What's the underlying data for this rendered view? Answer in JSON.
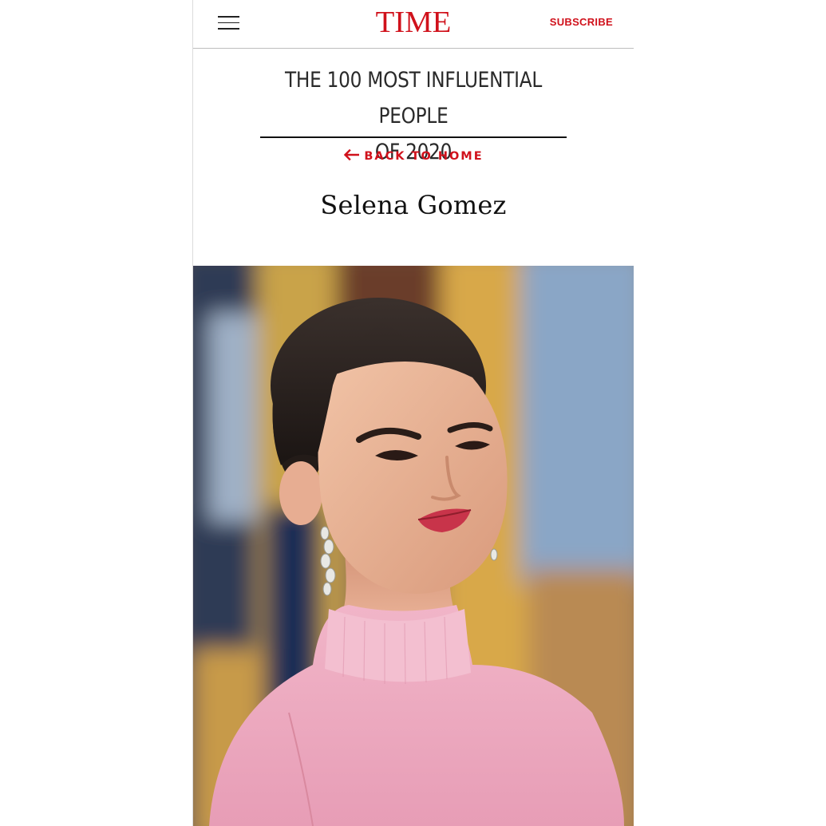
{
  "header": {
    "logo": "TIME",
    "subscribe_label": "SUBSCRIBE",
    "menu_icon": "hamburger-menu-icon"
  },
  "section": {
    "title_line1": "THE 100 MOST INFLUENTIAL PEOPLE",
    "title_line2": "OF 2020",
    "back_label": "BACK TO HOME",
    "back_icon": "arrow-left-icon"
  },
  "person": {
    "name": "Selena Gomez"
  },
  "colors": {
    "brand_red": "#d0111b",
    "text_dark": "#111111"
  }
}
